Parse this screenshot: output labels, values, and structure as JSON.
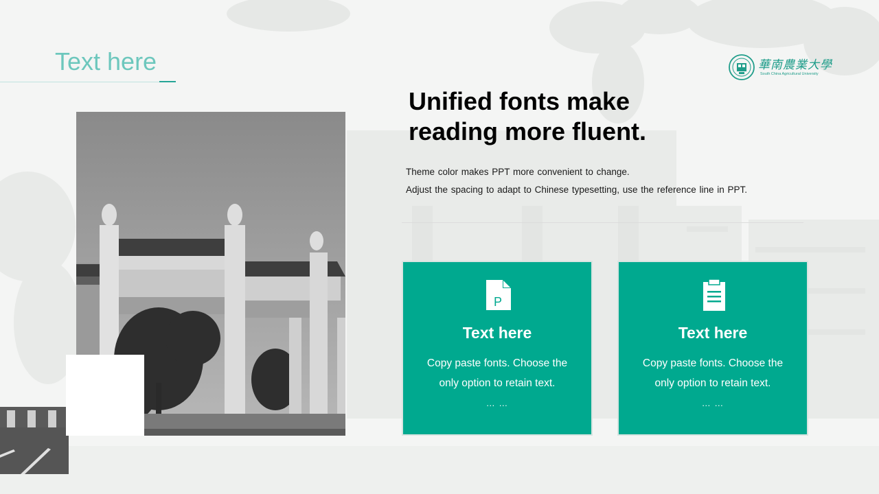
{
  "slide": {
    "title": "Text here"
  },
  "logo": {
    "name": "華南農業大學",
    "subtitle": "South China Agricultural University"
  },
  "main": {
    "headline_line1": "Unified fonts make",
    "headline_line2": "reading more fluent.",
    "body_line1": "Theme color makes PPT more convenient to change.",
    "body_line2": "Adjust the spacing to adapt to Chinese typesetting, use the reference line in PPT."
  },
  "cards": [
    {
      "icon": "presentation-file-icon",
      "icon_letter": "P",
      "title": "Text here",
      "text_line1": "Copy paste fonts. Choose the",
      "text_line2": "only option to retain text.",
      "ellipsis": "… …"
    },
    {
      "icon": "clipboard-list-icon",
      "title": "Text here",
      "text_line1": "Copy paste fonts. Choose the",
      "text_line2": "only option to retain text.",
      "ellipsis": "… …"
    }
  ],
  "colors": {
    "accent": "#00a98f",
    "title_teal": "#6dc7bd",
    "background": "#f4f5f4"
  }
}
